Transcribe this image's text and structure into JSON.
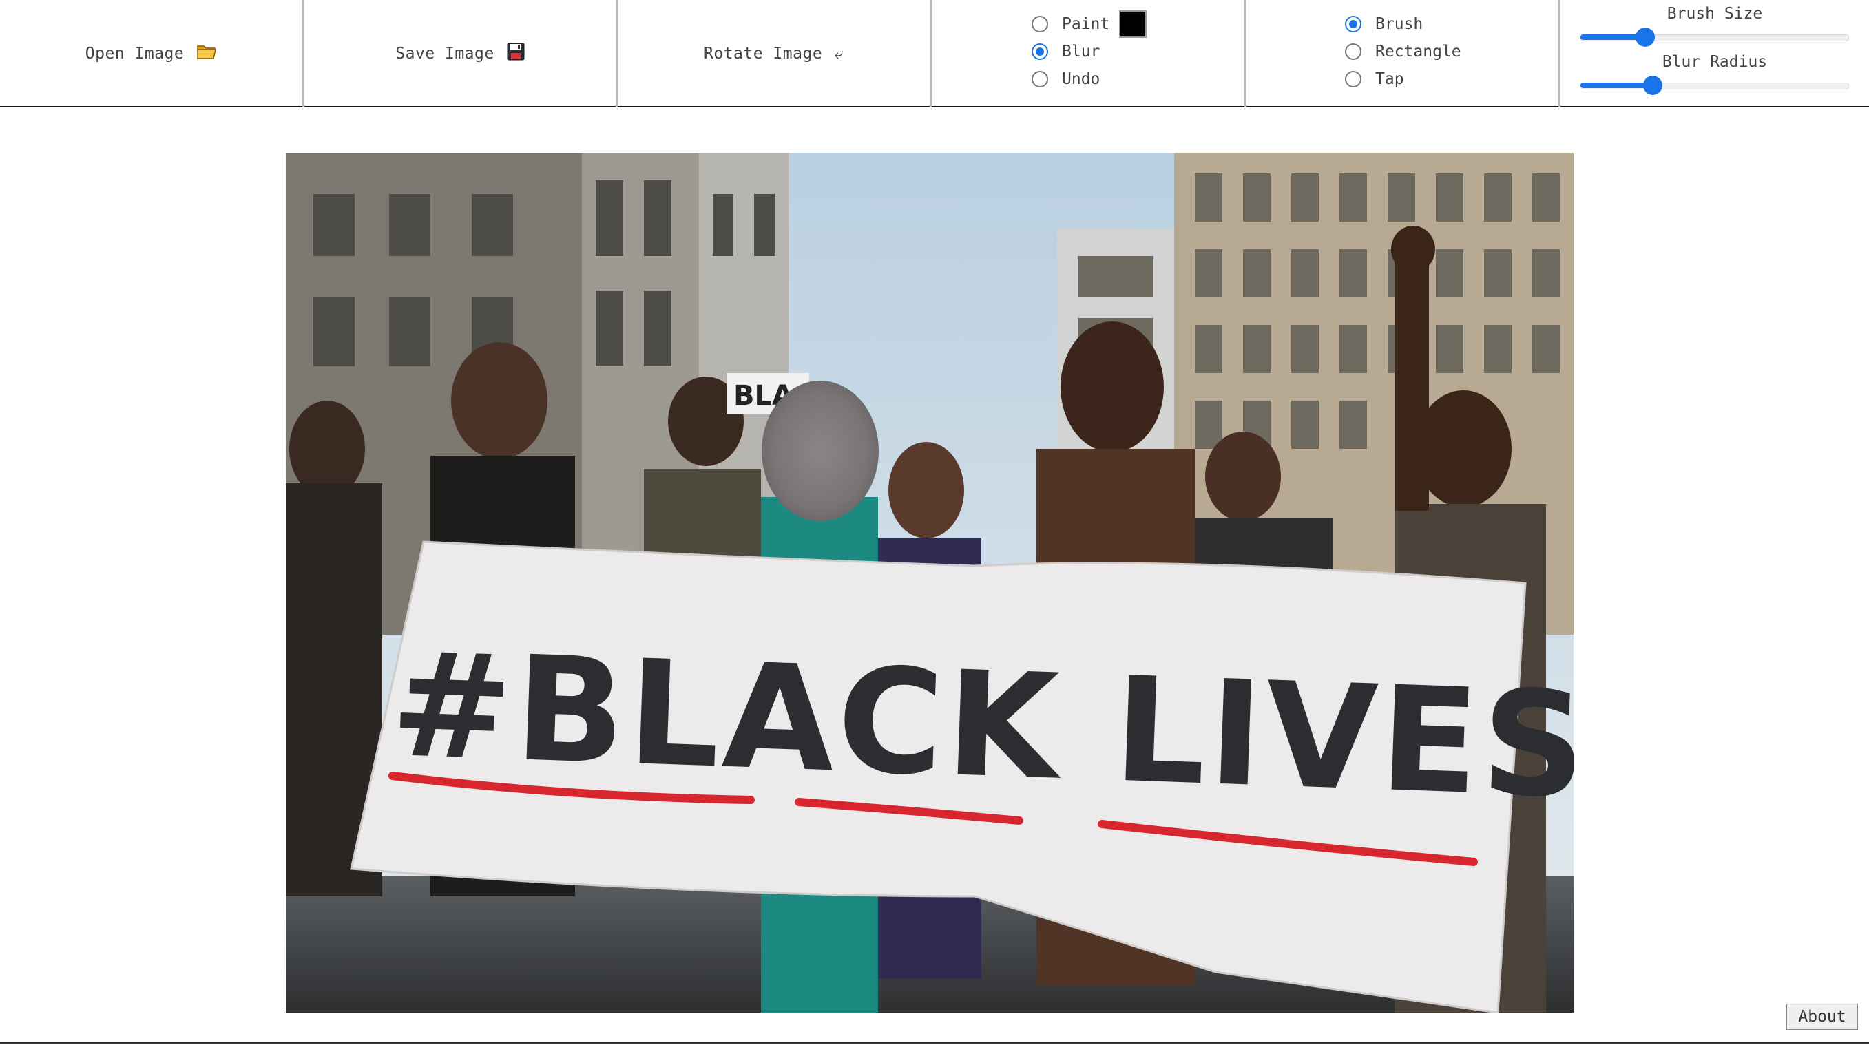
{
  "toolbar": {
    "open_label": "Open Image",
    "open_icon": "folder-icon",
    "save_label": "Save Image",
    "save_icon": "floppy-disk-icon",
    "rotate_label": "Rotate Image",
    "rotate_icon": "rotate-arrow-icon",
    "mode_options": [
      {
        "label": "Paint",
        "checked": false
      },
      {
        "label": "Blur",
        "checked": true
      },
      {
        "label": "Undo",
        "checked": false
      }
    ],
    "paint_color": "#000000",
    "tool_options": [
      {
        "label": "Brush",
        "checked": true
      },
      {
        "label": "Rectangle",
        "checked": false
      },
      {
        "label": "Tap",
        "checked": false
      }
    ],
    "brush_size": {
      "label": "Brush Size",
      "fraction": 0.24
    },
    "blur_radius": {
      "label": "Blur Radius",
      "fraction": 0.27
    }
  },
  "canvas": {
    "banner_text": "#BLACK LIVES MATTER",
    "sign_text": "BLACK",
    "accent_red": "#d7262e"
  },
  "about_label": "About",
  "colors": {
    "accent": "#1a73e8",
    "divider": "#b8b8b8"
  }
}
